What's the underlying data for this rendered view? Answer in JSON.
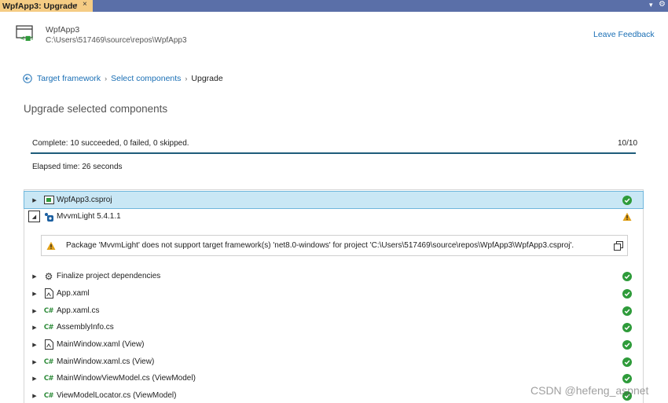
{
  "tab": {
    "title": "WpfApp3: Upgrade",
    "pin_glyph": "⊸",
    "close_glyph": "×"
  },
  "strip": {
    "menu_glyph": "▾",
    "settings_glyph": "⚙"
  },
  "project": {
    "name": "WpfApp3",
    "path": "C:\\Users\\517469\\source\\repos\\WpfApp3"
  },
  "header": {
    "leave_feedback": "Leave Feedback"
  },
  "breadcrumb": {
    "step1": "Target framework",
    "step2": "Select components",
    "current": "Upgrade",
    "separator": "›"
  },
  "section": {
    "title": "Upgrade selected components"
  },
  "progress": {
    "status": "Complete: 10 succeeded, 0 failed, 0 skipped.",
    "count": "10/10",
    "fraction": 1.0,
    "elapsed": "Elapsed time: 26 seconds"
  },
  "colors": {
    "accent": "#1a6fb5",
    "success": "#2e9b3a",
    "warning": "#e0a018",
    "tab_active": "#f5cc84",
    "strip": "#5a6fa8"
  },
  "items": [
    {
      "label": "WpfApp3.csproj",
      "icon": "project-icon",
      "status": "success",
      "expanded": false,
      "selected": true
    },
    {
      "label": "MvvmLight 5.4.1.1",
      "icon": "package-icon",
      "status": "warning",
      "expanded": true,
      "selected": false
    },
    {
      "label": "Finalize project dependencies",
      "icon": "gear-icon",
      "status": "success",
      "expanded": false
    },
    {
      "label": "App.xaml",
      "icon": "xaml-file-icon",
      "status": "success",
      "expanded": false
    },
    {
      "label": "App.xaml.cs",
      "icon": "csharp-file-icon",
      "status": "success",
      "expanded": false
    },
    {
      "label": "AssemblyInfo.cs",
      "icon": "csharp-file-icon",
      "status": "success",
      "expanded": false
    },
    {
      "label": "MainWindow.xaml (View)",
      "icon": "xaml-file-icon",
      "status": "success",
      "expanded": false
    },
    {
      "label": "MainWindow.xaml.cs (View)",
      "icon": "csharp-file-icon",
      "status": "success",
      "expanded": false
    },
    {
      "label": "MainWindowViewModel.cs (ViewModel)",
      "icon": "csharp-file-icon",
      "status": "success",
      "expanded": false
    },
    {
      "label": "ViewModelLocator.cs (ViewModel)",
      "icon": "csharp-file-icon",
      "status": "success",
      "expanded": false
    }
  ],
  "warning_message": "Package 'MvvmLight' does not support target framework(s) 'net8.0-windows' for project 'C:\\Users\\517469\\source\\repos\\WpfApp3\\WpfApp3.csproj'.",
  "csharp_glyph": "C#",
  "watermark": "CSDN @hefeng_aspnet"
}
